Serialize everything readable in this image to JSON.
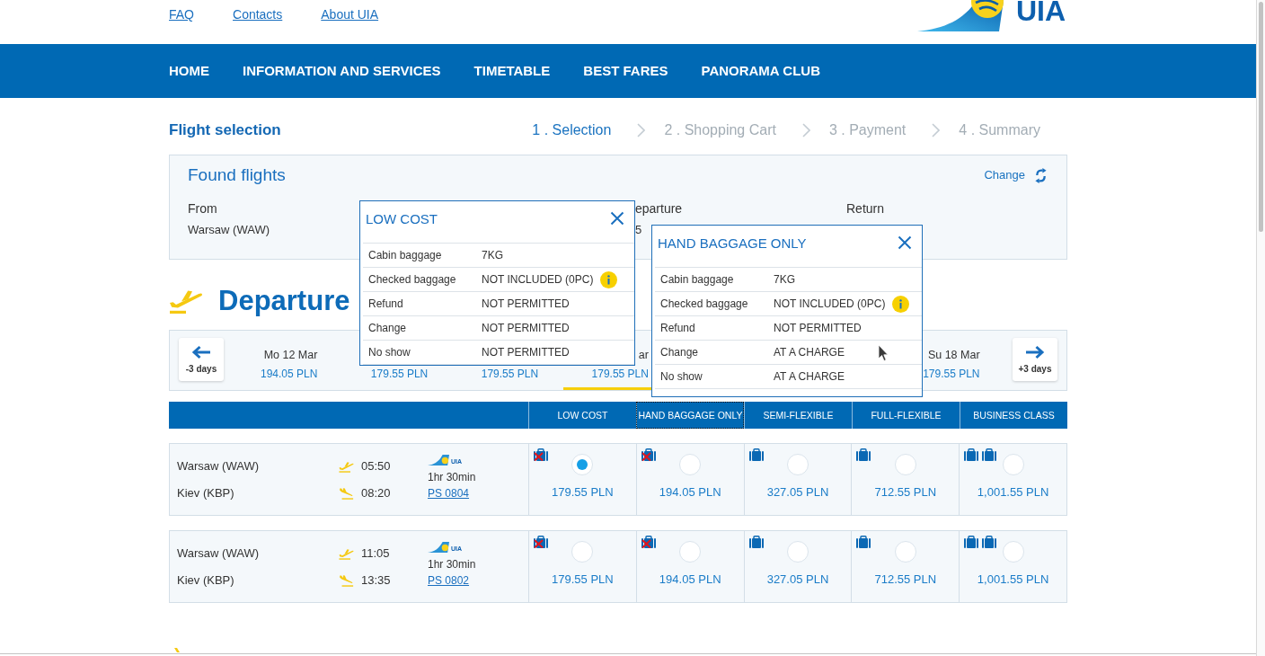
{
  "top_links": [
    {
      "label": "FAQ"
    },
    {
      "label": "Contacts"
    },
    {
      "label": "About UIA"
    }
  ],
  "logo": {
    "text": "UIA"
  },
  "nav": [
    {
      "label": "HOME"
    },
    {
      "label": "INFORMATION AND SERVICES"
    },
    {
      "label": "TIMETABLE"
    },
    {
      "label": "BEST FARES"
    },
    {
      "label": "PANORAMA CLUB"
    }
  ],
  "page_title": "Flight selection",
  "steps": [
    {
      "label": "1 . Selection",
      "selected": true
    },
    {
      "label": "2 . Shopping Cart",
      "selected": false
    },
    {
      "label": "3 . Payment",
      "selected": false
    },
    {
      "label": "4 . Summary",
      "selected": false
    }
  ],
  "found_flights": {
    "title": "Found flights",
    "change_link": "Change",
    "columns": [
      {
        "label": "From",
        "value": "Warsaw (WAW)"
      },
      {
        "label": "eparture",
        "value": "5"
      },
      {
        "label": "Return"
      }
    ]
  },
  "departure": {
    "title": "Departure",
    "prev_button": "-3 days",
    "next_button": "+3 days",
    "days": [
      {
        "label": "Mo 12 Mar",
        "price": "194.05 PLN",
        "selected": false
      },
      {
        "price": "179.55 PLN",
        "selected": false
      },
      {
        "price": "179.55 PLN",
        "selected": false
      },
      {
        "label": "ar",
        "price": "179.55 PLN",
        "selected": true
      },
      {
        "label": "Su 18 Mar",
        "price": "179.55 PLN",
        "selected": false
      }
    ],
    "fare_columns": [
      {
        "label": "LOW COST",
        "focused": false
      },
      {
        "label": "HAND BAGGAGE ONLY",
        "focused": true
      },
      {
        "label": "SEMI-FLEXIBLE",
        "focused": false
      },
      {
        "label": "FULL-FLEXIBLE",
        "focused": false
      },
      {
        "label": "BUSINESS CLASS",
        "focused": false
      }
    ],
    "flights": [
      {
        "from": "Warsaw (WAW)",
        "departs": "05:50",
        "to": "Kiev (KBP)",
        "arrives": "08:20",
        "carrier": "UIA",
        "duration": "1hr 30min",
        "flight_number": "PS 0804",
        "fares": [
          {
            "kind": "no-bag",
            "selected": true,
            "price": "179.55 PLN"
          },
          {
            "kind": "no-bag",
            "selected": false,
            "price": "194.05 PLN"
          },
          {
            "kind": "one-bag",
            "selected": false,
            "price": "327.05 PLN"
          },
          {
            "kind": "one-bag",
            "selected": false,
            "price": "712.55 PLN"
          },
          {
            "kind": "two-bags",
            "selected": false,
            "price": "1,001.55 PLN"
          }
        ]
      },
      {
        "from": "Warsaw (WAW)",
        "departs": "11:05",
        "to": "Kiev (KBP)",
        "arrives": "13:35",
        "carrier": "UIA",
        "duration": "1hr 30min",
        "flight_number": "PS 0802",
        "fares": [
          {
            "kind": "no-bag",
            "selected": false,
            "price": "179.55 PLN"
          },
          {
            "kind": "no-bag",
            "selected": false,
            "price": "194.05 PLN"
          },
          {
            "kind": "one-bag",
            "selected": false,
            "price": "327.05 PLN"
          },
          {
            "kind": "one-bag",
            "selected": false,
            "price": "712.55 PLN"
          },
          {
            "kind": "two-bags",
            "selected": false,
            "price": "1,001.55 PLN"
          }
        ]
      }
    ]
  },
  "fare_popups": [
    {
      "title": "LOW COST",
      "rows": [
        {
          "label": "Cabin baggage",
          "value": "7KG",
          "info": false
        },
        {
          "label": "Checked baggage",
          "value": "NOT INCLUDED (0PC)",
          "info": true
        },
        {
          "label": "Refund",
          "value": "NOT PERMITTED",
          "info": false
        },
        {
          "label": "Change",
          "value": "NOT PERMITTED",
          "info": false
        },
        {
          "label": "No show",
          "value": "NOT PERMITTED",
          "info": false
        }
      ]
    },
    {
      "title": "HAND BAGGAGE ONLY",
      "rows": [
        {
          "label": "Cabin baggage",
          "value": "7KG",
          "info": false
        },
        {
          "label": "Checked baggage",
          "value": "NOT INCLUDED (0PC)",
          "info": true
        },
        {
          "label": "Refund",
          "value": "NOT PERMITTED",
          "info": false
        },
        {
          "label": "Change",
          "value": "AT A CHARGE",
          "info": false
        },
        {
          "label": "No show",
          "value": "AT A CHARGE",
          "info": false
        }
      ]
    }
  ]
}
